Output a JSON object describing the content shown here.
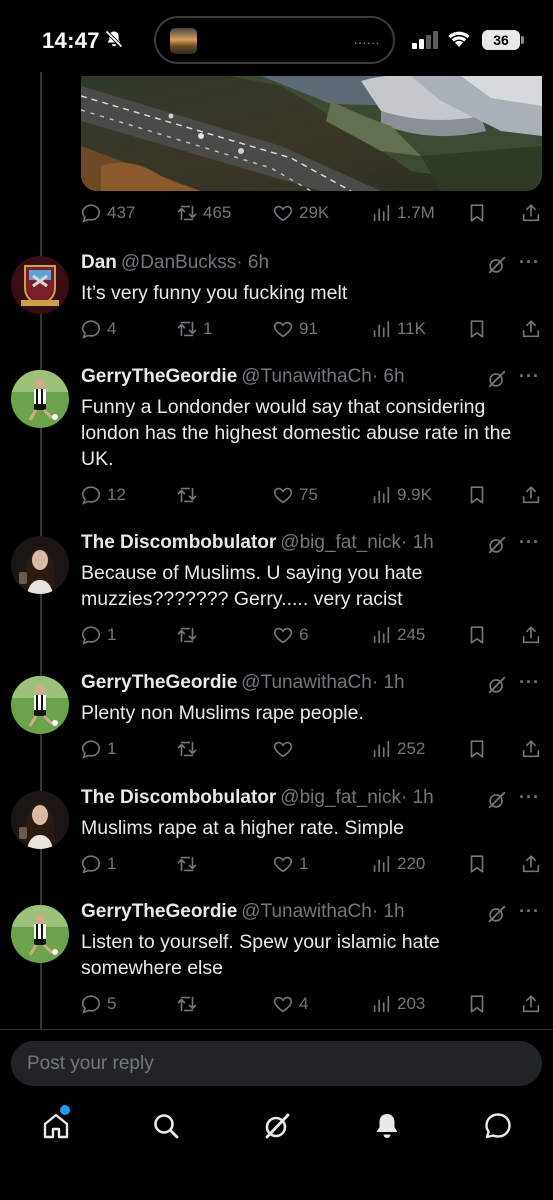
{
  "status_bar": {
    "time": "14:47",
    "battery": "36",
    "island_dots": "......"
  },
  "main_tweet": {
    "stats": {
      "replies": "437",
      "reposts": "465",
      "likes": "29K",
      "views": "1.7M"
    }
  },
  "replies": [
    {
      "name": "Dan",
      "handle": "@DanBuckss",
      "time": "· 6h",
      "text": "It’s very funny you fucking melt",
      "stats": {
        "replies": "4",
        "reposts": "1",
        "likes": "91",
        "views": "11K"
      }
    },
    {
      "name": "GerryTheGeordie",
      "handle": "@TunawithaCh",
      "time": "· 6h",
      "text": "Funny a Londonder would say that considering london has the highest domestic abuse rate in the UK.",
      "stats": {
        "replies": "12",
        "reposts": "",
        "likes": "75",
        "views": "9.9K"
      }
    },
    {
      "name": "The Discombobulator",
      "handle": "@big_fat_nick",
      "time": "· 1h",
      "text": "Because of Muslims. U saying you hate muzzies??????? Gerry..... very racist",
      "stats": {
        "replies": "1",
        "reposts": "",
        "likes": "6",
        "views": "245"
      }
    },
    {
      "name": "GerryTheGeordie",
      "handle": "@TunawithaCh",
      "time": "· 1h",
      "text": "Plenty non Muslims rape people.",
      "stats": {
        "replies": "1",
        "reposts": "",
        "likes": "",
        "views": "252"
      }
    },
    {
      "name": "The Discombobulator",
      "handle": "@big_fat_nick",
      "time": "· 1h",
      "text": "Muslims rape at a higher rate. Simple",
      "stats": {
        "replies": "1",
        "reposts": "",
        "likes": "1",
        "views": "220"
      }
    },
    {
      "name": "GerryTheGeordie",
      "handle": "@TunawithaCh",
      "time": "· 1h",
      "text": "Listen to yourself.  Spew your islamic hate somewhere else",
      "stats": {
        "replies": "5",
        "reposts": "",
        "likes": "4",
        "views": "203"
      }
    }
  ],
  "composer": {
    "placeholder": "Post your reply"
  },
  "tabs": [
    "home-icon",
    "search-icon",
    "grok-icon",
    "notifications-icon",
    "messages-icon"
  ],
  "colors": {
    "background": "#000000",
    "muted": "#71767b",
    "text": "#e7e9ea",
    "accent": "#1d9bf0"
  }
}
